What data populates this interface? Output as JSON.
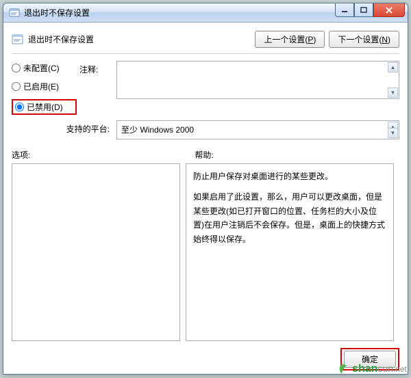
{
  "window": {
    "title": "退出时不保存设置",
    "page_title": "退出时不保存设置"
  },
  "nav": {
    "prev": "上一个设置(",
    "prev_key": "P",
    "next": "下一个设置(",
    "next_key": "N",
    "close_paren": ")"
  },
  "radios": {
    "not_configured": "未配置(",
    "not_configured_key": "C",
    "enabled": "已启用(",
    "enabled_key": "E",
    "disabled": "已禁用(",
    "disabled_key": "D",
    "close_paren": ")"
  },
  "labels": {
    "comment": "注释:",
    "platform": "支持的平台:",
    "options": "选项:",
    "help": "帮助:"
  },
  "platform_value": "至少 Windows 2000",
  "help_text": {
    "p1": "防止用户保存对桌面进行的某些更改。",
    "p2": "如果启用了此设置，那么，用户可以更改桌面，但是某些更改(如已打开窗口的位置、任务栏的大小及位置)在用户注销后不会保存。但是，桌面上的快捷方式始终得以保存。"
  },
  "footer": {
    "ok": "确定"
  },
  "watermark": {
    "brand1": "shan",
    "brand2": "cun",
    "tld": ".net"
  }
}
